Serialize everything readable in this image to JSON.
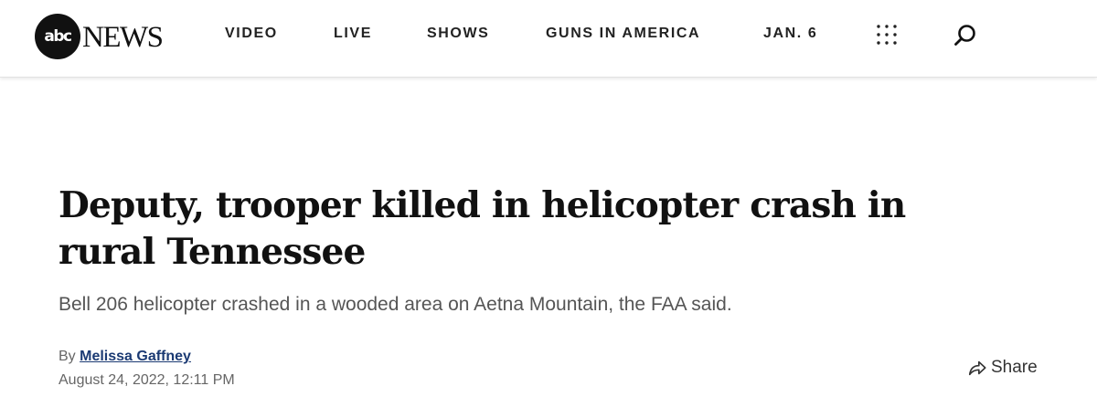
{
  "header": {
    "logo": {
      "badge": "abc",
      "word": "NEWS"
    },
    "nav": [
      {
        "label": "VIDEO"
      },
      {
        "label": "LIVE"
      },
      {
        "label": "SHOWS"
      },
      {
        "label": "GUNS IN AMERICA"
      },
      {
        "label": "JAN. 6"
      }
    ],
    "icons": {
      "menu": "grid-menu-icon",
      "search": "search-icon"
    }
  },
  "article": {
    "headline": "Deputy, trooper killed in helicopter crash in rural Tennessee",
    "subheadline": "Bell 206 helicopter crashed in a wooded area on Aetna Mountain, the FAA said.",
    "byline": {
      "prefix": "By",
      "author": "Melissa Gaffney"
    },
    "date": "August 24, 2022, 12:11 PM",
    "share": {
      "label": "Share",
      "icon": "share-arrow-icon"
    }
  },
  "colors": {
    "author_link": "#1b3a73",
    "subhead_text": "#555555",
    "meta_text": "#666666",
    "header_border": "#e2e2e2"
  }
}
